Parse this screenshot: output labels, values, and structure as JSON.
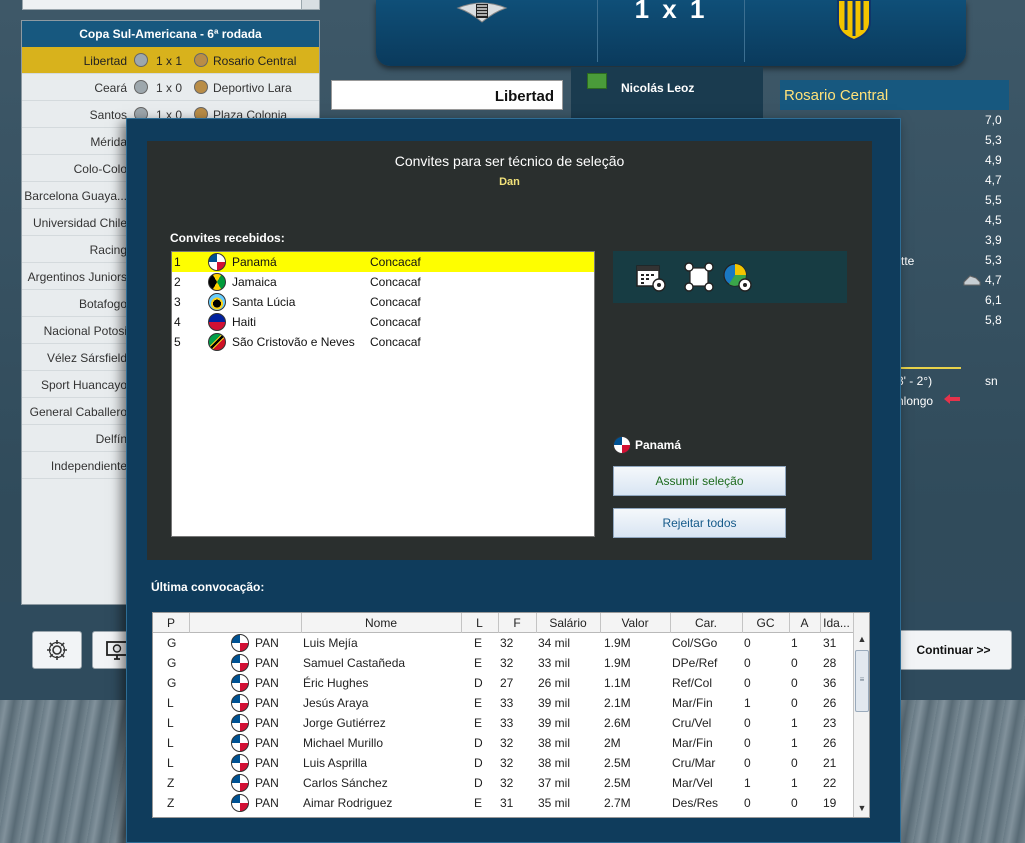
{
  "results_panel": {
    "title": "Copa Sul-Americana - 6ª rodada",
    "matches": [
      {
        "home": "Libertad",
        "score": "1 x 1",
        "away": "Rosario Central",
        "selected": true
      },
      {
        "home": "Ceará",
        "score": "1 x 0",
        "away": "Deportivo Lara"
      },
      {
        "home": "Santos",
        "score": "1 x 0",
        "away": "Plaza Colonia"
      },
      {
        "home": "Mérida",
        "score": "",
        "away": ""
      },
      {
        "home": "Colo-Colo",
        "score": "",
        "away": ""
      },
      {
        "home": "Barcelona Guaya...",
        "score": "",
        "away": ""
      },
      {
        "home": "Universidad Chile",
        "score": "",
        "away": ""
      },
      {
        "home": "Racing",
        "score": "",
        "away": ""
      },
      {
        "home": "Argentinos Juniors",
        "score": "",
        "away": ""
      },
      {
        "home": "Botafogo",
        "score": "",
        "away": ""
      },
      {
        "home": "Nacional Potosi",
        "score": "",
        "away": ""
      },
      {
        "home": "Vélez Sársfield",
        "score": "",
        "away": ""
      },
      {
        "home": "Sport Huancayo",
        "score": "",
        "away": ""
      },
      {
        "home": "General Caballero",
        "score": "",
        "away": ""
      },
      {
        "home": "Delfín",
        "score": "",
        "away": ""
      },
      {
        "home": "Independiente",
        "score": "",
        "away": ""
      }
    ]
  },
  "scoreboard": {
    "score": "1 x 1"
  },
  "behind": {
    "left_team": "Libertad",
    "coach_name": "Nicolás Leoz",
    "right_team": "Rosario Central",
    "ratings": [
      "7,0",
      "5,3",
      "4,9",
      "4,7",
      "5,5",
      "4,5",
      "3,9",
      "5,3",
      "4,7",
      "6,1",
      "5,8"
    ],
    "frag_tte": "tte",
    "frag_time": "3' - 2°)",
    "frag_sn": "sn",
    "frag_nlongo": "nlongo",
    "continue_label": "Continuar >>"
  },
  "modal": {
    "title": "Convites para ser técnico de seleção",
    "subtitle": "Dan",
    "received_label": "Convites recebidos:",
    "invites": [
      {
        "num": "1",
        "country": "Panamá",
        "confederation": "Concacaf",
        "flag": "f-pan",
        "selected": true
      },
      {
        "num": "2",
        "country": "Jamaica",
        "confederation": "Concacaf",
        "flag": "f-jam"
      },
      {
        "num": "3",
        "country": "Santa Lúcia",
        "confederation": "Concacaf",
        "flag": "f-lca"
      },
      {
        "num": "4",
        "country": "Haiti",
        "confederation": "Concacaf",
        "flag": "f-hti"
      },
      {
        "num": "5",
        "country": "São Cristovão e Neves",
        "confederation": "Concacaf",
        "flag": "f-skn"
      }
    ],
    "selected_country": "Panamá",
    "assume_label": "Assumir seleção",
    "reject_label": "Rejeitar todos",
    "last_call_label": "Última convocação:",
    "table_headers": [
      "P",
      "",
      "Nome",
      "L",
      "F",
      "Salário",
      "Valor",
      "Car.",
      "GC",
      "A",
      "Ida..."
    ],
    "players": [
      {
        "p": "G",
        "nat": "PAN",
        "name": "Luis Mejía",
        "l": "E",
        "f": "32",
        "salary": "34 mil",
        "value": "1.9M",
        "car": "Col/SGo",
        "gc": "0",
        "a": "1",
        "age": "31"
      },
      {
        "p": "G",
        "nat": "PAN",
        "name": "Samuel Castañeda",
        "l": "E",
        "f": "32",
        "salary": "33 mil",
        "value": "1.9M",
        "car": "DPe/Ref",
        "gc": "0",
        "a": "0",
        "age": "28"
      },
      {
        "p": "G",
        "nat": "PAN",
        "name": "Éric Hughes",
        "l": "D",
        "f": "27",
        "salary": "26 mil",
        "value": "1.1M",
        "car": "Ref/Col",
        "gc": "0",
        "a": "0",
        "age": "36"
      },
      {
        "p": "L",
        "nat": "PAN",
        "name": "Jesús Araya",
        "l": "E",
        "f": "33",
        "salary": "39 mil",
        "value": "2.1M",
        "car": "Mar/Fin",
        "gc": "1",
        "a": "0",
        "age": "26"
      },
      {
        "p": "L",
        "nat": "PAN",
        "name": "Jorge Gutiérrez",
        "l": "E",
        "f": "33",
        "salary": "39 mil",
        "value": "2.6M",
        "car": "Cru/Vel",
        "gc": "0",
        "a": "1",
        "age": "23"
      },
      {
        "p": "L",
        "nat": "PAN",
        "name": "Michael Murillo",
        "l": "D",
        "f": "32",
        "salary": "38 mil",
        "value": "2M",
        "car": "Mar/Fin",
        "gc": "0",
        "a": "1",
        "age": "26"
      },
      {
        "p": "L",
        "nat": "PAN",
        "name": "Luis Asprilla",
        "l": "D",
        "f": "32",
        "salary": "38 mil",
        "value": "2.5M",
        "car": "Cru/Mar",
        "gc": "0",
        "a": "0",
        "age": "21"
      },
      {
        "p": "Z",
        "nat": "PAN",
        "name": "Carlos Sánchez",
        "l": "D",
        "f": "32",
        "salary": "37 mil",
        "value": "2.5M",
        "car": "Mar/Vel",
        "gc": "1",
        "a": "1",
        "age": "22"
      },
      {
        "p": "Z",
        "nat": "PAN",
        "name": "Aimar Rodriguez",
        "l": "E",
        "f": "31",
        "salary": "35 mil",
        "value": "2.7M",
        "car": "Des/Res",
        "gc": "0",
        "a": "0",
        "age": "19"
      }
    ]
  },
  "icons": {
    "calendar": "calendar-ball-icon",
    "formation": "formation-icon",
    "stats": "pie-chart-ball-icon",
    "settings": "gear-icon",
    "monitor": "monitor-icon"
  }
}
